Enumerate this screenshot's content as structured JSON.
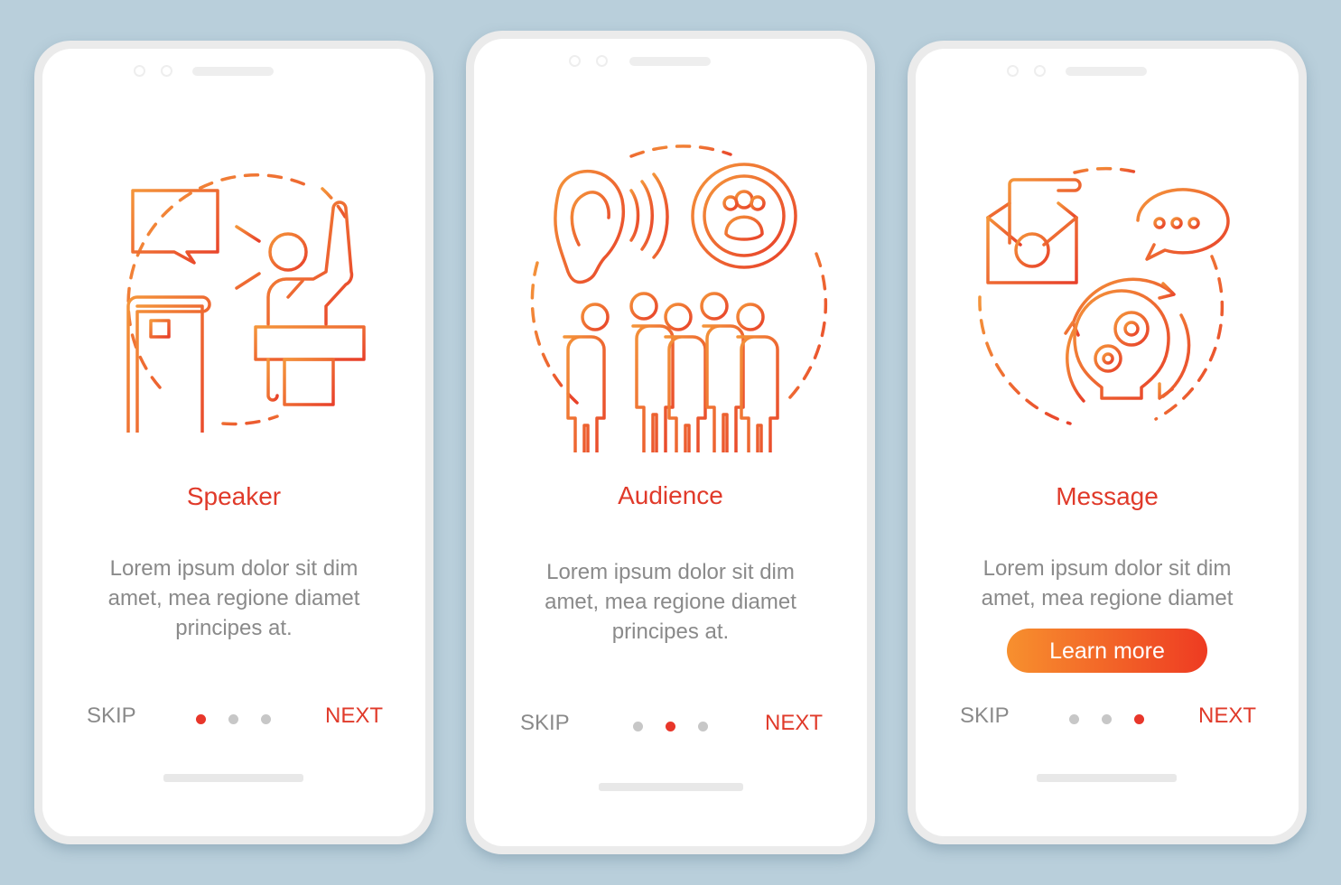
{
  "colors": {
    "accent_red": "#e03a2a",
    "accent_orange": "#f7902e",
    "background": "#b9cfdb",
    "text_gray": "#8a8a8a",
    "dot_inactive": "#c7c7c7"
  },
  "screens": [
    {
      "title": "Speaker",
      "description": "Lorem ipsum dolor sit dim amet, mea regione diamet principes at.",
      "illustration": "speaker-at-podium-icon",
      "skip_label": "SKIP",
      "next_label": "NEXT",
      "page_index": 1,
      "page_count": 3
    },
    {
      "title": "Audience",
      "description": "Lorem ipsum dolor sit dim amet, mea regione diamet principes at.",
      "illustration": "audience-target-icon",
      "skip_label": "SKIP",
      "next_label": "NEXT",
      "page_index": 2,
      "page_count": 3
    },
    {
      "title": "Message",
      "description": "Lorem ipsum dolor sit dim amet, mea regione diamet",
      "illustration": "message-idea-icon",
      "button_label": "Learn more",
      "skip_label": "SKIP",
      "next_label": "NEXT",
      "page_index": 3,
      "page_count": 3
    }
  ]
}
